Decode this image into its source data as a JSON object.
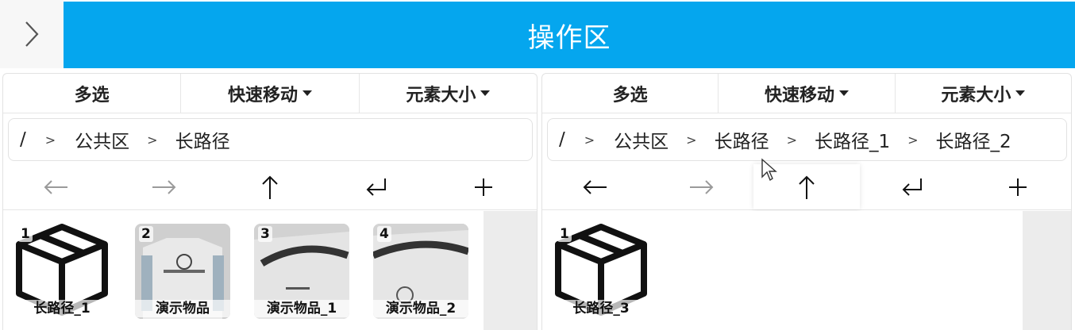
{
  "header": {
    "title": "操作区",
    "toggle_icon": "chevron-right-icon"
  },
  "panels": [
    {
      "toolbar": {
        "multi_select": "多选",
        "quick_move": "快速移动",
        "element_size": "元素大小"
      },
      "breadcrumb": [
        "/",
        "公共区",
        "长路径"
      ],
      "nav": [
        "arrow-left-icon",
        "arrow-right-icon",
        "arrow-up-icon",
        "enter-icon",
        "plus-icon"
      ],
      "items": [
        {
          "index": "1",
          "label": "长路径_1",
          "kind": "folder"
        },
        {
          "index": "2",
          "label": "演示物品",
          "kind": "image"
        },
        {
          "index": "3",
          "label": "演示物品_1",
          "kind": "image"
        },
        {
          "index": "4",
          "label": "演示物品_2",
          "kind": "image"
        }
      ]
    },
    {
      "toolbar": {
        "multi_select": "多选",
        "quick_move": "快速移动",
        "element_size": "元素大小"
      },
      "breadcrumb": [
        "/",
        "公共区",
        "长路径",
        "长路径_1",
        "长路径_2"
      ],
      "nav": [
        "arrow-left-icon",
        "arrow-right-icon",
        "arrow-up-icon",
        "enter-icon",
        "plus-icon"
      ],
      "items": [
        {
          "index": "1",
          "label": "长路径_3",
          "kind": "folder"
        }
      ]
    }
  ],
  "colors": {
    "header_bg": "#05a6ee",
    "nav_disabled": "#9a9a9a",
    "nav_active": "#111111"
  }
}
